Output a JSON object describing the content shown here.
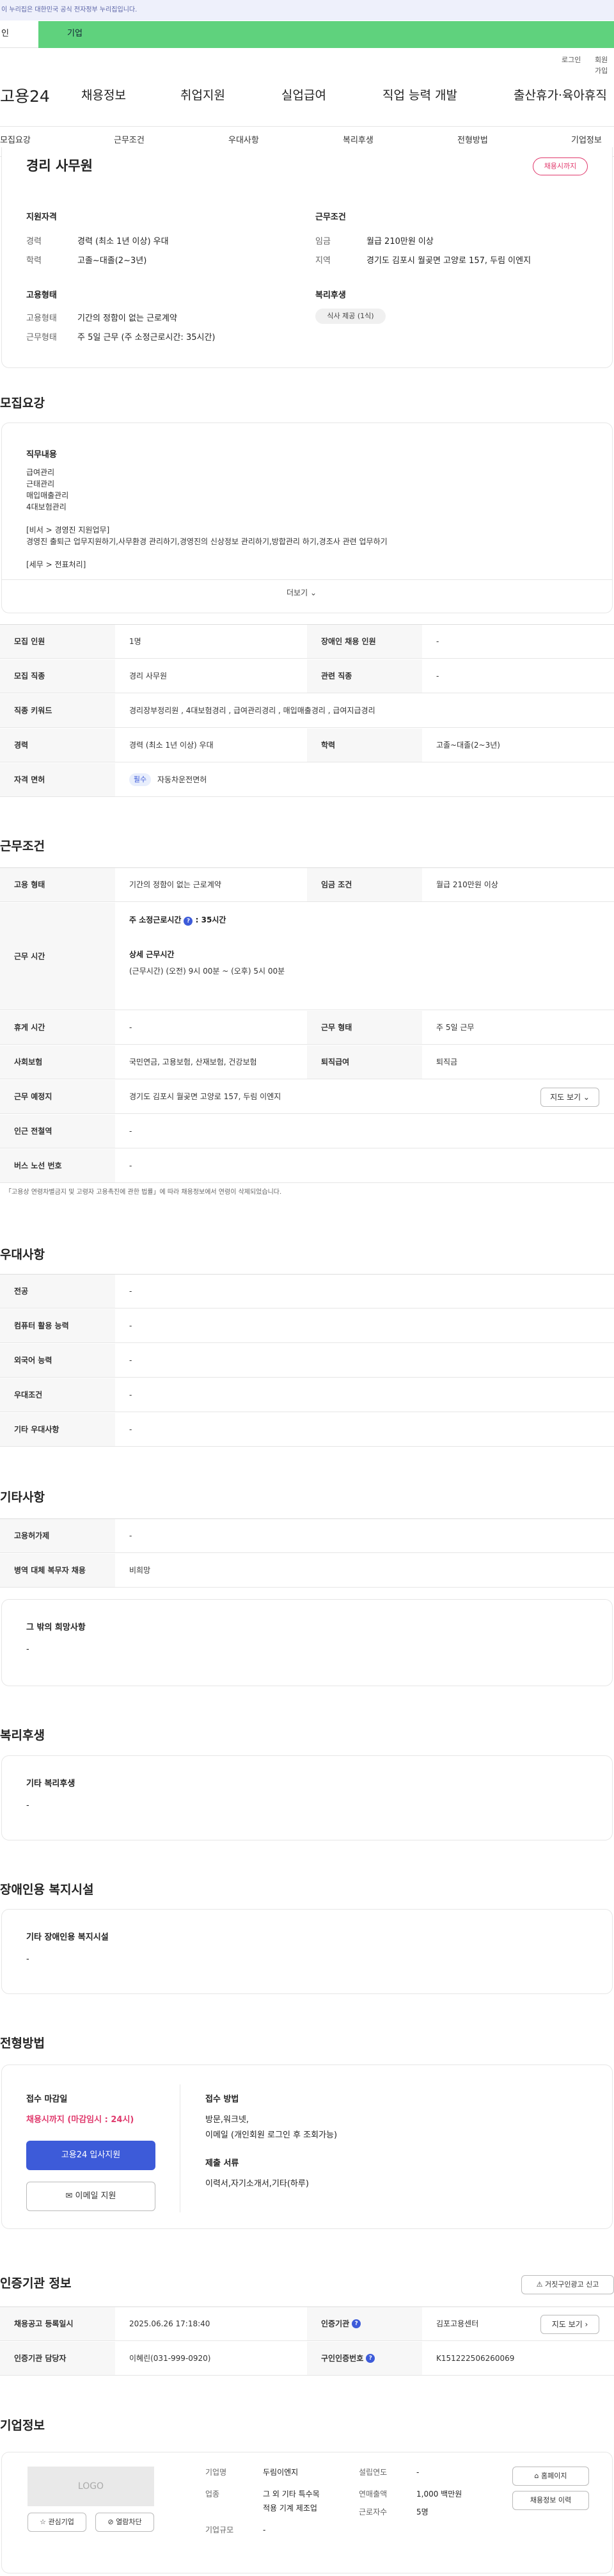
{
  "top_notice": "이 누리집은 대한민국 공식 전자정부 누리집입니다.",
  "user_toggle": {
    "person": "인",
    "company": "기업"
  },
  "util": {
    "login": "로그인",
    "signup": "회원가입"
  },
  "gnb": {
    "logo": "고용24",
    "items": [
      "채용정보",
      "취업지원",
      "실업급여",
      "직업 능력 개발",
      "출산휴가·육아휴직"
    ]
  },
  "subnav": [
    "모집요강",
    "근무조건",
    "우대사항",
    "복리후생",
    "전형방법",
    "기업정보"
  ],
  "summary": {
    "title": "경리 사무원",
    "deadline_badge": "채용시까지",
    "qual_heading": "지원자격",
    "career_label": "경력",
    "career_value": "경력 (최소 1년 이상) 우대",
    "edu_label": "학력",
    "edu_value": "고졸~대졸(2~3년)",
    "cond_heading": "근무조건",
    "wage_label": "임금",
    "wage_value": "월급 210만원 이상",
    "area_label": "지역",
    "area_value": "경기도 김포시 월곶면 고양로 157, 두림 이엔지",
    "emp_heading": "고용형태",
    "emptype_label": "고용형태",
    "emptype_value": "기간의 정함이 없는 근로계약",
    "worktype_label": "근무형태",
    "worktype_value": "주 5일 근무 (주 소정근로시간: 35시간)",
    "welfare_heading": "복리후생",
    "welfare_tag": "식사 제공 (1식)"
  },
  "recruit": {
    "heading": "모집요강",
    "duty_heading": "직무내용",
    "duty_lines": [
      "급여관리",
      "근태관리",
      "매입매출관리",
      "4대보험관리",
      "",
      "[비서 > 경영진 지원업무]",
      "경영진 출퇴근 업무지원하기,사무환경 관리하기,경영진의 신상정보 관리하기,방합관리 하기,경조사 관련 업무하기",
      "",
      "[세무 > 전표처리]"
    ],
    "more": "더보기",
    "rows": [
      {
        "l1": "모집 인원",
        "v1": "1명",
        "l2": "장애인 채용 인원",
        "v2": "-"
      },
      {
        "l1": "모집 직종",
        "v1": "경리 사무원",
        "l2": "관련 직종",
        "v2": "-"
      },
      {
        "l1": "직종 키워드",
        "v1": "경리장부정리원 , 4대보험경리 , 급여관리경리 , 매입매출경리 , 급여지급경리"
      },
      {
        "l1": "경력",
        "v1": "경력 (최소 1년 이상) 우대",
        "l2": "학력",
        "v2": "고졸~대졸(2~3년)"
      },
      {
        "l1": "자격 면허",
        "tag": "필수",
        "v1": "자동차운전면허"
      }
    ]
  },
  "work": {
    "heading": "근무조건",
    "emptype_label": "고용 형태",
    "emptype_value": "기간의 정함이 없는 근로계약",
    "wage_label": "임금 조건",
    "wage_value": "월급 210만원 이상",
    "hours_label": "근무 시간",
    "hours_sub1": "주 소정근로시간",
    "hours_sub1_value": ": 35시간",
    "hours_sub2": "상세 근무시간",
    "hours_detail": "(근무시간) (오전) 9시 00분 ~ (오후) 5시 00분",
    "rest_label": "휴게 시간",
    "rest_value": "-",
    "form_label": "근무 형태",
    "form_value": "주 5일 근무",
    "ins_label": "사회보험",
    "ins_value": "국민연금, 고용보험, 산재보험, 건강보험",
    "retire_label": "퇴직급여",
    "retire_value": "퇴직금",
    "place_label": "근무 예정지",
    "place_value": "경기도 김포시 월곶면 고양로 157, 두림 이엔지",
    "map_btn": "지도 보기",
    "station_label": "인근 전철역",
    "station_value": "-",
    "bus_label": "버스 노선 번호",
    "bus_value": "-",
    "note": "「고용상 연령차별금지 및 고령자 고용촉진에 관한 법률」에 따라 채용정보에서 연령이 삭제되었습니다."
  },
  "pref": {
    "heading": "우대사항",
    "rows": [
      {
        "l": "전공",
        "v": "-"
      },
      {
        "l": "컴퓨터 활용 능력",
        "v": "-"
      },
      {
        "l": "외국어 능력",
        "v": "-"
      },
      {
        "l": "우대조건",
        "v": "-"
      },
      {
        "l": "기타 우대사항",
        "v": "-"
      }
    ]
  },
  "etc": {
    "heading": "기타사항",
    "rows": [
      {
        "l": "고용허가제",
        "v": "-"
      },
      {
        "l": "병역 대체 복무자 채용",
        "v": "비희망"
      }
    ],
    "box_title": "그 밖의 희망사항",
    "box_value": "-"
  },
  "welfare": {
    "heading": "복리후생",
    "box_title": "기타 복리후생",
    "box_value": "-"
  },
  "disab": {
    "heading": "장애인용 복지시설",
    "box_title": "기타 장애인용 복지시설",
    "box_value": "-"
  },
  "selection": {
    "heading": "전형방법",
    "deadline_label": "접수 마감일",
    "deadline_value": "채용시까지 (마감임시 : 24시)",
    "apply_btn": "고용24 입사지원",
    "email_btn": "이메일 지원",
    "method_label": "접수 방법",
    "method_value1": "방문,워크넷,",
    "method_value2": "이메일 (개인회원 로그인 후 조회가능)",
    "docs_label": "제출 서류",
    "docs_value": "이력서,자기소개서,기타(하루)"
  },
  "agency": {
    "heading": "인증기관 정보",
    "report_btn": "거짓구인광고 신고",
    "reg_label": "채용공고 등록일시",
    "reg_value": "2025.06.26 17:18:40",
    "org_label": "인증기관",
    "org_value": "김포고용센터",
    "map_btn": "지도 보기",
    "mgr_label": "인증기관 담당자",
    "mgr_value": "이혜린(031-999-0920)",
    "no_label": "구인인증번호",
    "no_value": "K151222506260069"
  },
  "company": {
    "heading": "기업정보",
    "logo_text": "LOGO",
    "fav_btn": "관심기업",
    "block_btn": "열람차단",
    "name_label": "기업명",
    "name_value": "두림이엔지",
    "industry_label": "업종",
    "industry_value1": "그 외 기타 특수목",
    "industry_value2": "적용 기계 제조업",
    "size_label": "기업규모",
    "size_value": "-",
    "year_label": "설립연도",
    "year_value": "-",
    "sales_label": "연매출액",
    "sales_value": "1,000 백만원",
    "staff_label": "근로자수",
    "staff_value": "5명",
    "home_btn": "홈페이지",
    "jobs_btn": "채용정보 이력"
  }
}
